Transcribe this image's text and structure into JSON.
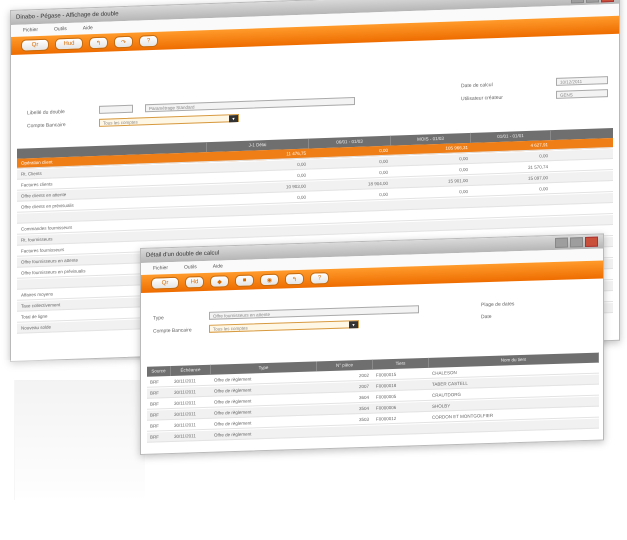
{
  "back_window": {
    "title": "Dinabo - Pégase - Affichage de double",
    "menu": [
      "Fichier",
      "Outils",
      "Aide"
    ],
    "toolbar": [
      "Qr",
      "Hud",
      "↰",
      "↷",
      "?"
    ],
    "form": {
      "label_code": "Libellé du double",
      "code_value": "",
      "code_desc": "Paramétrage Standard",
      "label_compte": "Compte Bancaire",
      "compte_value": "Tous les comptes",
      "label_date": "Date de calcul",
      "date_value": "10/12/2011",
      "label_user": "Utilisateur créateur",
      "user_value": "GENS"
    },
    "columns": [
      "",
      "J-1 Délai",
      "06/01 - 01/03",
      "MOIS - 01/03",
      "01/01 - 01/01"
    ],
    "rows": [
      {
        "label": "Opération client",
        "v": [
          "11 476,75",
          "0,00",
          "105 966,31",
          "4 627,91"
        ],
        "hl": true
      },
      {
        "label": "Rt. Clients",
        "v": [
          "0,00",
          "0,00",
          "0,00",
          "0,00"
        ]
      },
      {
        "label": "Factures clients",
        "v": [
          "0,00",
          "0,00",
          "0,00",
          "31 570,74"
        ]
      },
      {
        "label": "Offre clients en attente",
        "v": [
          "10 903,00",
          "18 904,00",
          "15 901,00",
          "15 097,00"
        ]
      },
      {
        "label": "Offre clients en prévisualis",
        "v": [
          "0,00",
          "0,00",
          "0,00",
          "0,00"
        ]
      },
      {
        "label": "",
        "v": [
          "",
          "",
          "",
          ""
        ]
      },
      {
        "label": "Commandes fournisseurs",
        "v": [
          "",
          "",
          "",
          ""
        ]
      },
      {
        "label": "Rt. fournisseurs",
        "v": [
          "",
          "",
          "",
          ""
        ]
      },
      {
        "label": "Factures fournisseurs",
        "v": [
          "",
          "",
          "",
          ""
        ]
      },
      {
        "label": "Offre fournisseurs en attente",
        "v": [
          "",
          "",
          "",
          ""
        ]
      },
      {
        "label": "Offre fournisseurs en prévisualis",
        "v": [
          "",
          "",
          "",
          ""
        ]
      },
      {
        "label": "",
        "v": [
          "",
          "",
          "",
          ""
        ]
      },
      {
        "label": "Affaires moyens",
        "v": [
          "",
          "",
          "",
          ""
        ]
      },
      {
        "label": "Taxe collectivement",
        "v": [
          "",
          "",
          "",
          ""
        ]
      },
      {
        "label": "Total de ligne",
        "v": [
          "",
          "",
          "",
          ""
        ]
      },
      {
        "label": "Nouveau solde",
        "v": [
          "",
          "",
          "",
          ""
        ]
      }
    ]
  },
  "front_window": {
    "title": "Détail d'un double de calcul",
    "menu": [
      "Fichier",
      "Outils",
      "Aide"
    ],
    "toolbar": [
      "Qr",
      "Hd",
      "◆",
      "■",
      "◉",
      "↰",
      "?"
    ],
    "form": {
      "label_type": "Type",
      "type_value": "Offre fournisseurs en attente",
      "label_compte": "Compte Bancaire",
      "compte_value": "Tous les comptes",
      "label_plage": "Plage de dates",
      "label_date": "Date"
    },
    "columns": [
      "Source",
      "Échéance",
      "Type",
      "N° pièce",
      "Tiers",
      "Nom du tiers"
    ],
    "rows": [
      [
        "BRF",
        "30/11/2011",
        "Offre de règlement",
        "2002",
        "F0000015",
        "CHALESON"
      ],
      [
        "BRF",
        "30/11/2011",
        "Offre de règlement",
        "2007",
        "F0000018",
        "TABER CASTELL"
      ],
      [
        "BRF",
        "30/11/2011",
        "Offre de règlement",
        "3604",
        "F0000005",
        "CRAUTDORG"
      ],
      [
        "BRF",
        "30/11/2011",
        "Offre de règlement",
        "3504",
        "F0000006",
        "SHOLBY"
      ],
      [
        "BRF",
        "30/11/2011",
        "Offre de règlement",
        "3503",
        "F0000012",
        "CORDON ET MONTGOLFIER"
      ],
      [
        "BRF",
        "30/11/2011",
        "Offre de règlement",
        "",
        "",
        ""
      ]
    ]
  }
}
